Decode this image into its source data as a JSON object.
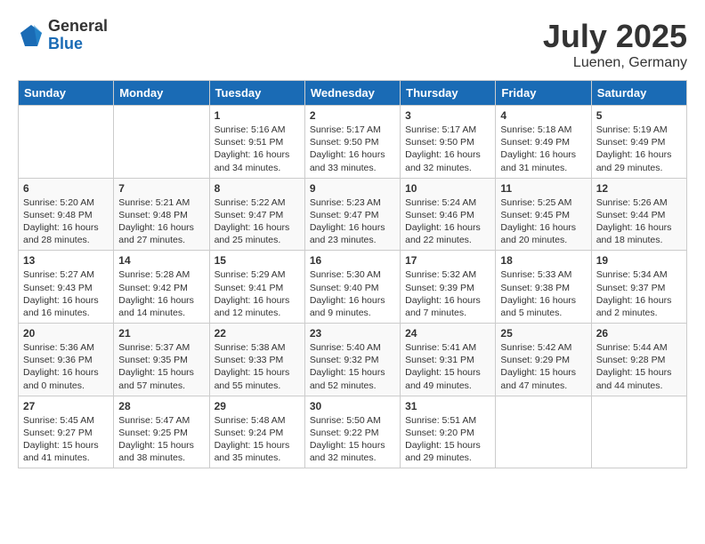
{
  "logo": {
    "general": "General",
    "blue": "Blue"
  },
  "title": {
    "month_year": "July 2025",
    "location": "Luenen, Germany"
  },
  "headers": [
    "Sunday",
    "Monday",
    "Tuesday",
    "Wednesday",
    "Thursday",
    "Friday",
    "Saturday"
  ],
  "weeks": [
    [
      {
        "day": "",
        "sunrise": "",
        "sunset": "",
        "daylight": ""
      },
      {
        "day": "",
        "sunrise": "",
        "sunset": "",
        "daylight": ""
      },
      {
        "day": "1",
        "sunrise": "Sunrise: 5:16 AM",
        "sunset": "Sunset: 9:51 PM",
        "daylight": "Daylight: 16 hours and 34 minutes."
      },
      {
        "day": "2",
        "sunrise": "Sunrise: 5:17 AM",
        "sunset": "Sunset: 9:50 PM",
        "daylight": "Daylight: 16 hours and 33 minutes."
      },
      {
        "day": "3",
        "sunrise": "Sunrise: 5:17 AM",
        "sunset": "Sunset: 9:50 PM",
        "daylight": "Daylight: 16 hours and 32 minutes."
      },
      {
        "day": "4",
        "sunrise": "Sunrise: 5:18 AM",
        "sunset": "Sunset: 9:49 PM",
        "daylight": "Daylight: 16 hours and 31 minutes."
      },
      {
        "day": "5",
        "sunrise": "Sunrise: 5:19 AM",
        "sunset": "Sunset: 9:49 PM",
        "daylight": "Daylight: 16 hours and 29 minutes."
      }
    ],
    [
      {
        "day": "6",
        "sunrise": "Sunrise: 5:20 AM",
        "sunset": "Sunset: 9:48 PM",
        "daylight": "Daylight: 16 hours and 28 minutes."
      },
      {
        "day": "7",
        "sunrise": "Sunrise: 5:21 AM",
        "sunset": "Sunset: 9:48 PM",
        "daylight": "Daylight: 16 hours and 27 minutes."
      },
      {
        "day": "8",
        "sunrise": "Sunrise: 5:22 AM",
        "sunset": "Sunset: 9:47 PM",
        "daylight": "Daylight: 16 hours and 25 minutes."
      },
      {
        "day": "9",
        "sunrise": "Sunrise: 5:23 AM",
        "sunset": "Sunset: 9:47 PM",
        "daylight": "Daylight: 16 hours and 23 minutes."
      },
      {
        "day": "10",
        "sunrise": "Sunrise: 5:24 AM",
        "sunset": "Sunset: 9:46 PM",
        "daylight": "Daylight: 16 hours and 22 minutes."
      },
      {
        "day": "11",
        "sunrise": "Sunrise: 5:25 AM",
        "sunset": "Sunset: 9:45 PM",
        "daylight": "Daylight: 16 hours and 20 minutes."
      },
      {
        "day": "12",
        "sunrise": "Sunrise: 5:26 AM",
        "sunset": "Sunset: 9:44 PM",
        "daylight": "Daylight: 16 hours and 18 minutes."
      }
    ],
    [
      {
        "day": "13",
        "sunrise": "Sunrise: 5:27 AM",
        "sunset": "Sunset: 9:43 PM",
        "daylight": "Daylight: 16 hours and 16 minutes."
      },
      {
        "day": "14",
        "sunrise": "Sunrise: 5:28 AM",
        "sunset": "Sunset: 9:42 PM",
        "daylight": "Daylight: 16 hours and 14 minutes."
      },
      {
        "day": "15",
        "sunrise": "Sunrise: 5:29 AM",
        "sunset": "Sunset: 9:41 PM",
        "daylight": "Daylight: 16 hours and 12 minutes."
      },
      {
        "day": "16",
        "sunrise": "Sunrise: 5:30 AM",
        "sunset": "Sunset: 9:40 PM",
        "daylight": "Daylight: 16 hours and 9 minutes."
      },
      {
        "day": "17",
        "sunrise": "Sunrise: 5:32 AM",
        "sunset": "Sunset: 9:39 PM",
        "daylight": "Daylight: 16 hours and 7 minutes."
      },
      {
        "day": "18",
        "sunrise": "Sunrise: 5:33 AM",
        "sunset": "Sunset: 9:38 PM",
        "daylight": "Daylight: 16 hours and 5 minutes."
      },
      {
        "day": "19",
        "sunrise": "Sunrise: 5:34 AM",
        "sunset": "Sunset: 9:37 PM",
        "daylight": "Daylight: 16 hours and 2 minutes."
      }
    ],
    [
      {
        "day": "20",
        "sunrise": "Sunrise: 5:36 AM",
        "sunset": "Sunset: 9:36 PM",
        "daylight": "Daylight: 16 hours and 0 minutes."
      },
      {
        "day": "21",
        "sunrise": "Sunrise: 5:37 AM",
        "sunset": "Sunset: 9:35 PM",
        "daylight": "Daylight: 15 hours and 57 minutes."
      },
      {
        "day": "22",
        "sunrise": "Sunrise: 5:38 AM",
        "sunset": "Sunset: 9:33 PM",
        "daylight": "Daylight: 15 hours and 55 minutes."
      },
      {
        "day": "23",
        "sunrise": "Sunrise: 5:40 AM",
        "sunset": "Sunset: 9:32 PM",
        "daylight": "Daylight: 15 hours and 52 minutes."
      },
      {
        "day": "24",
        "sunrise": "Sunrise: 5:41 AM",
        "sunset": "Sunset: 9:31 PM",
        "daylight": "Daylight: 15 hours and 49 minutes."
      },
      {
        "day": "25",
        "sunrise": "Sunrise: 5:42 AM",
        "sunset": "Sunset: 9:29 PM",
        "daylight": "Daylight: 15 hours and 47 minutes."
      },
      {
        "day": "26",
        "sunrise": "Sunrise: 5:44 AM",
        "sunset": "Sunset: 9:28 PM",
        "daylight": "Daylight: 15 hours and 44 minutes."
      }
    ],
    [
      {
        "day": "27",
        "sunrise": "Sunrise: 5:45 AM",
        "sunset": "Sunset: 9:27 PM",
        "daylight": "Daylight: 15 hours and 41 minutes."
      },
      {
        "day": "28",
        "sunrise": "Sunrise: 5:47 AM",
        "sunset": "Sunset: 9:25 PM",
        "daylight": "Daylight: 15 hours and 38 minutes."
      },
      {
        "day": "29",
        "sunrise": "Sunrise: 5:48 AM",
        "sunset": "Sunset: 9:24 PM",
        "daylight": "Daylight: 15 hours and 35 minutes."
      },
      {
        "day": "30",
        "sunrise": "Sunrise: 5:50 AM",
        "sunset": "Sunset: 9:22 PM",
        "daylight": "Daylight: 15 hours and 32 minutes."
      },
      {
        "day": "31",
        "sunrise": "Sunrise: 5:51 AM",
        "sunset": "Sunset: 9:20 PM",
        "daylight": "Daylight: 15 hours and 29 minutes."
      },
      {
        "day": "",
        "sunrise": "",
        "sunset": "",
        "daylight": ""
      },
      {
        "day": "",
        "sunrise": "",
        "sunset": "",
        "daylight": ""
      }
    ]
  ]
}
